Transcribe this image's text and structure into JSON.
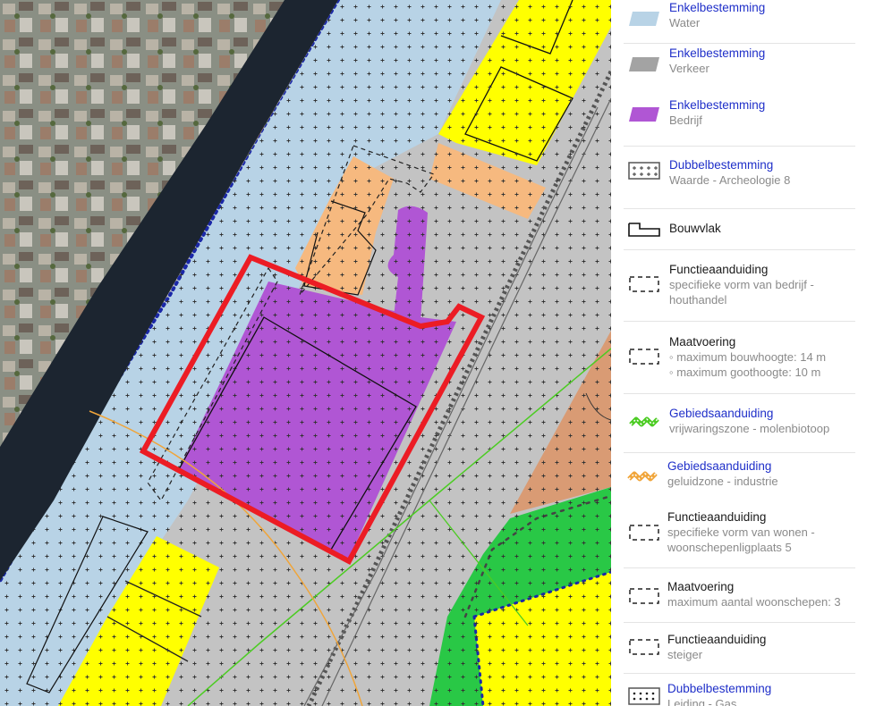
{
  "map": {
    "colors": {
      "water": "#b8d3e6",
      "verkeer": "#c3c3c3",
      "bedrijf": "#b056d4",
      "wonen_yellow": "#ffff00",
      "orange_parcel": "#f6b97f",
      "brown_parcel": "#d99b74",
      "green": "#29c846",
      "highlight_red": "#ec1c24",
      "river": "#1c2530"
    }
  },
  "legend": {
    "items": [
      {
        "title": "Enkelbestemming",
        "lines": [
          "Water"
        ],
        "symbol": "water-swatch-icon",
        "color": "#b8d3e6",
        "link": true
      },
      {
        "title": "Enkelbestemming",
        "lines": [
          "Verkeer"
        ],
        "symbol": "verkeer-swatch-icon",
        "color": "#a3a3a3",
        "link": true
      },
      {
        "title": "Enkelbestemming",
        "lines": [
          "Bedrijf"
        ],
        "symbol": "bedrijf-swatch-icon",
        "color": "#b056d4",
        "link": true
      },
      {
        "title": "Dubbelbestemming",
        "lines": [
          "Waarde - Archeologie 8"
        ],
        "symbol": "archeologie-hatch-icon",
        "link": true
      },
      {
        "title": "Bouwvlak",
        "lines": [],
        "symbol": "bouwvlak-outline-icon",
        "link": false
      },
      {
        "title": "Functieaanduiding",
        "lines": [
          "specifieke vorm van bedrijf -",
          "houthandel"
        ],
        "symbol": "dashed-box-icon",
        "link": false
      },
      {
        "title": "Maatvoering",
        "lines": [
          "◦ maximum bouwhoogte: 14 m",
          "◦ maximum goothoogte: 10 m"
        ],
        "symbol": "dashed-box-icon",
        "link": false
      },
      {
        "title": "Gebiedsaanduiding",
        "lines": [
          "vrijwaringszone - molenbiotoop"
        ],
        "symbol": "green-zone-line-icon",
        "color": "#4ccc23",
        "link": true
      },
      {
        "title": "Gebiedsaanduiding",
        "lines": [
          "geluidzone - industrie"
        ],
        "symbol": "orange-zone-line-icon",
        "color": "#f0a53a",
        "link": true
      },
      {
        "title": "Functieaanduiding",
        "lines": [
          "specifieke vorm van wonen -",
          "woonschepenligplaats 5"
        ],
        "symbol": "dashed-box-icon",
        "link": false
      },
      {
        "title": "Maatvoering",
        "lines": [
          "maximum aantal woonschepen: 3"
        ],
        "symbol": "dashed-box-icon",
        "link": false
      },
      {
        "title": "Functieaanduiding",
        "lines": [
          "steiger"
        ],
        "symbol": "dashed-box-icon",
        "link": false
      },
      {
        "title": "Dubbelbestemming",
        "lines": [
          "Leiding - Gas"
        ],
        "symbol": "gas-pipeline-icon",
        "link": true
      }
    ]
  }
}
